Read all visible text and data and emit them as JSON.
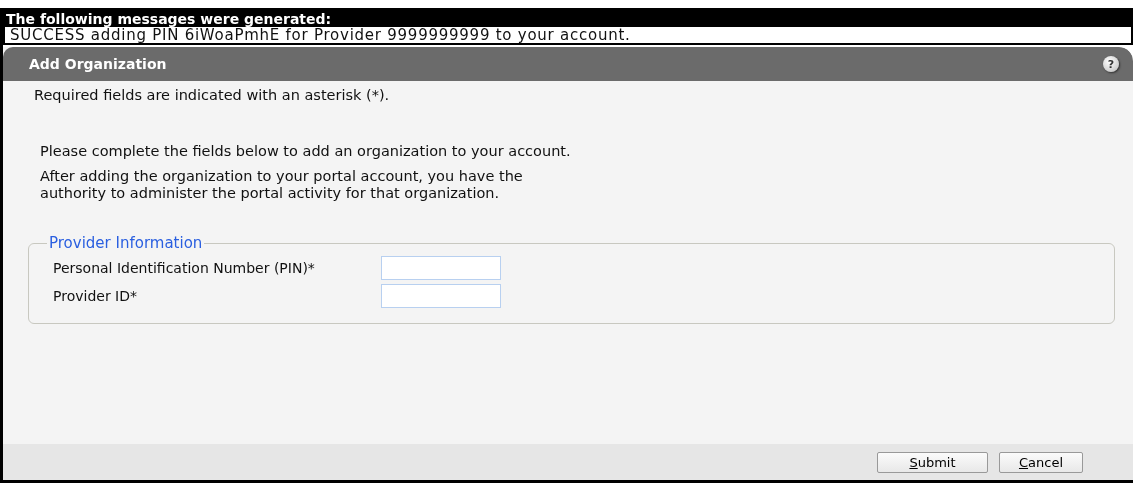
{
  "messages": {
    "title": "The following messages were generated:",
    "items": [
      "SUCCESS adding PIN 6iWoaPmhE for Provider 9999999999 to your account."
    ]
  },
  "panel": {
    "title": "Add Organization",
    "help_icon": "?",
    "required_note": "Required fields are indicated with an asterisk (*).",
    "paragraphs": [
      "Please complete the fields below to add an organization to your account.",
      "After adding the organization to your portal account, you have the\nauthority to administer the portal activity for that organization."
    ],
    "fieldset": {
      "legend": "Provider Information",
      "fields": [
        {
          "label": "Personal Identification Number (PIN)*"
        },
        {
          "label": "Provider ID*"
        }
      ]
    },
    "buttons": [
      {
        "label": "Submit"
      },
      {
        "label": "Cancel"
      }
    ]
  }
}
